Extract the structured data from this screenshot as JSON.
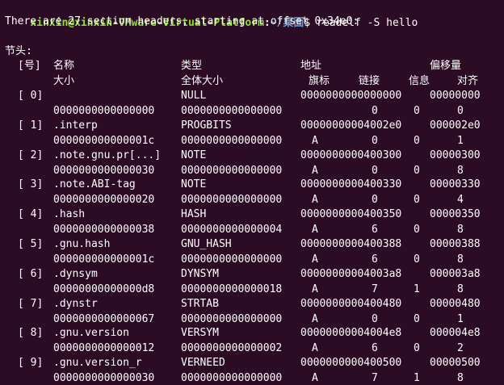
{
  "terminal": {
    "prompt": {
      "user_host": "xinxin@xinxin-VMware-Virtual-Platform",
      "colon": ":",
      "path": "~/桌面",
      "dollar": "$",
      "command": " readelf -S hello"
    },
    "summary": "There are 27 section headers, starting at offset 0x34e0:",
    "section_title": "节头:",
    "header1": {
      "nr": "[号]",
      "name": "名称",
      "type": "类型",
      "address": "地址",
      "offset": "偏移量"
    },
    "header2": {
      "size": "大小",
      "entsize": "全体大小",
      "flags": "旗标",
      "link": "链接",
      "info": "信息",
      "align": "对齐"
    },
    "sections": [
      {
        "nr": "[ 0]",
        "name": "",
        "type": "NULL",
        "address": "0000000000000000",
        "offset": "00000000",
        "size": "0000000000000000",
        "entsize": "0000000000000000",
        "flags": "",
        "link": "0",
        "info": "0",
        "align": "0"
      },
      {
        "nr": "[ 1]",
        "name": ".interp",
        "type": "PROGBITS",
        "address": "00000000004002e0",
        "offset": "000002e0",
        "size": "000000000000001c",
        "entsize": "0000000000000000",
        "flags": "A",
        "link": "0",
        "info": "0",
        "align": "1"
      },
      {
        "nr": "[ 2]",
        "name": ".note.gnu.pr[...]",
        "type": "NOTE",
        "address": "0000000000400300",
        "offset": "00000300",
        "size": "0000000000000030",
        "entsize": "0000000000000000",
        "flags": "A",
        "link": "0",
        "info": "0",
        "align": "8"
      },
      {
        "nr": "[ 3]",
        "name": ".note.ABI-tag",
        "type": "NOTE",
        "address": "0000000000400330",
        "offset": "00000330",
        "size": "0000000000000020",
        "entsize": "0000000000000000",
        "flags": "A",
        "link": "0",
        "info": "0",
        "align": "4"
      },
      {
        "nr": "[ 4]",
        "name": ".hash",
        "type": "HASH",
        "address": "0000000000400350",
        "offset": "00000350",
        "size": "0000000000000038",
        "entsize": "0000000000000004",
        "flags": "A",
        "link": "6",
        "info": "0",
        "align": "8"
      },
      {
        "nr": "[ 5]",
        "name": ".gnu.hash",
        "type": "GNU_HASH",
        "address": "0000000000400388",
        "offset": "00000388",
        "size": "000000000000001c",
        "entsize": "0000000000000000",
        "flags": "A",
        "link": "6",
        "info": "0",
        "align": "8"
      },
      {
        "nr": "[ 6]",
        "name": ".dynsym",
        "type": "DYNSYM",
        "address": "00000000004003a8",
        "offset": "000003a8",
        "size": "00000000000000d8",
        "entsize": "0000000000000018",
        "flags": "A",
        "link": "7",
        "info": "1",
        "align": "8"
      },
      {
        "nr": "[ 7]",
        "name": ".dynstr",
        "type": "STRTAB",
        "address": "0000000000400480",
        "offset": "00000480",
        "size": "0000000000000067",
        "entsize": "0000000000000000",
        "flags": "A",
        "link": "0",
        "info": "0",
        "align": "1"
      },
      {
        "nr": "[ 8]",
        "name": ".gnu.version",
        "type": "VERSYM",
        "address": "00000000004004e8",
        "offset": "000004e8",
        "size": "0000000000000012",
        "entsize": "0000000000000002",
        "flags": "A",
        "link": "6",
        "info": "0",
        "align": "2"
      },
      {
        "nr": "[ 9]",
        "name": ".gnu.version_r",
        "type": "VERNEED",
        "address": "0000000000400500",
        "offset": "00000500",
        "size": "0000000000000030",
        "entsize": "0000000000000000",
        "flags": "A",
        "link": "7",
        "info": "1",
        "align": "8"
      }
    ]
  }
}
